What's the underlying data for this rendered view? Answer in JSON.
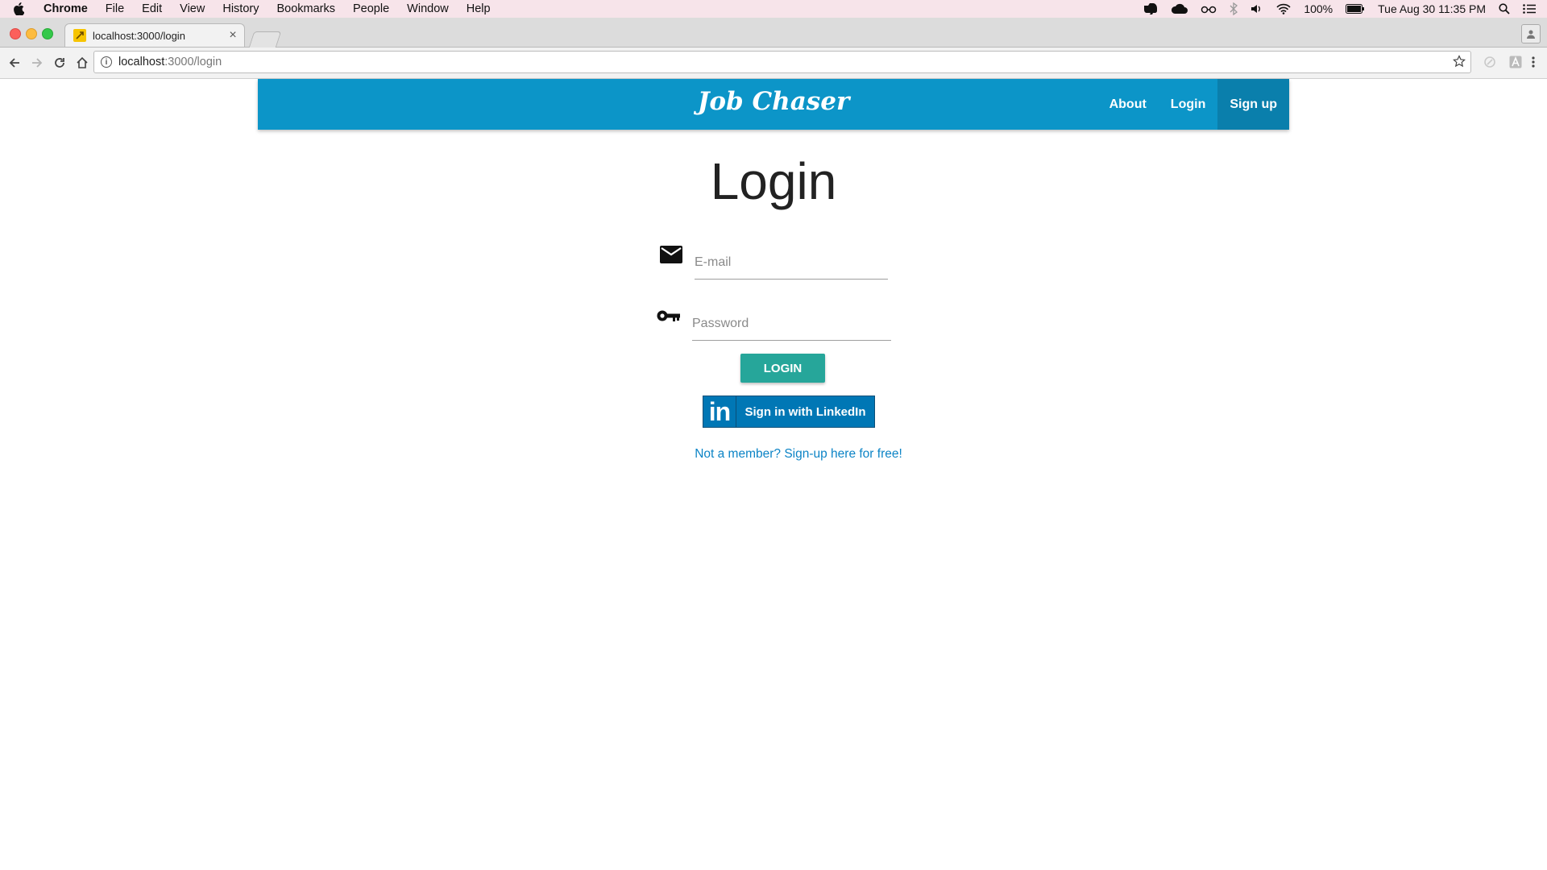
{
  "os_menubar": {
    "app_name": "Chrome",
    "menus": [
      "File",
      "Edit",
      "View",
      "History",
      "Bookmarks",
      "People",
      "Window",
      "Help"
    ],
    "battery": "100%",
    "datetime": "Tue Aug 30  11:35 PM"
  },
  "browser": {
    "tab": {
      "title": "localhost:3000/login",
      "close": "×"
    },
    "address": {
      "host": "localhost",
      "path": ":3000/login"
    }
  },
  "site": {
    "brand": "Job Chaser",
    "nav": {
      "about": "About",
      "login": "Login",
      "signup": "Sign up"
    },
    "colors": {
      "navbar": "#0c95c8",
      "navbar_active": "#0a7fac",
      "login_button": "#26a69a",
      "linkedin": "#0077b5",
      "link": "#0c84c6"
    }
  },
  "login_form": {
    "title": "Login",
    "email_placeholder": "E-mail",
    "email_icon": "envelope-icon",
    "password_placeholder": "Password",
    "password_icon": "key-icon",
    "submit_label": "LOGIN",
    "linkedin_logo": "in",
    "linkedin_label": "Sign in with LinkedIn",
    "signup_link": "Not a member? Sign-up here for free!"
  }
}
